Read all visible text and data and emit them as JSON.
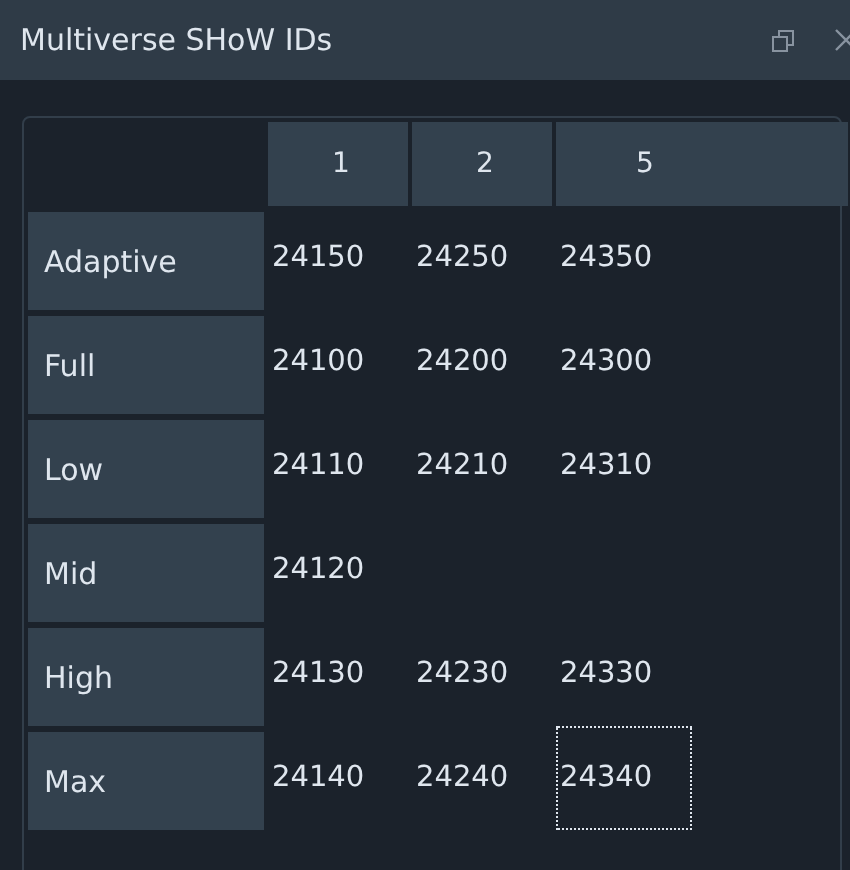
{
  "window": {
    "title": "Multiverse SHoW IDs"
  },
  "table": {
    "columns": [
      "1",
      "2",
      "5"
    ],
    "rows": [
      {
        "label": "Adaptive",
        "cells": [
          {
            "text": "24150",
            "focused": false
          },
          {
            "text": "24250",
            "focused": false
          },
          {
            "text": "24350",
            "focused": false
          }
        ]
      },
      {
        "label": "Full",
        "cells": [
          {
            "text": "24100",
            "focused": false
          },
          {
            "text": "24200",
            "focused": false
          },
          {
            "text": "24300",
            "focused": false
          }
        ]
      },
      {
        "label": "Low",
        "cells": [
          {
            "text": "24110",
            "focused": false
          },
          {
            "text": "24210",
            "focused": false
          },
          {
            "text": "24310",
            "focused": false
          }
        ]
      },
      {
        "label": "Mid",
        "cells": [
          {
            "text": "24120",
            "focused": false
          }
        ]
      },
      {
        "label": "High",
        "cells": [
          {
            "text": "24130",
            "focused": false
          },
          {
            "text": "24230",
            "focused": false
          },
          {
            "text": "24330",
            "focused": false
          }
        ]
      },
      {
        "label": "Max",
        "cells": [
          {
            "text": "24140",
            "focused": false
          },
          {
            "text": "24240",
            "focused": false
          },
          {
            "text": "24340",
            "focused": true
          }
        ]
      }
    ]
  }
}
